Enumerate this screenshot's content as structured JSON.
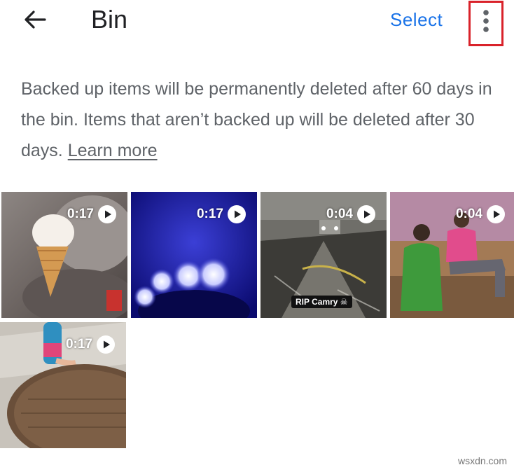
{
  "header": {
    "title": "Bin",
    "select_label": "Select",
    "back_icon": "arrow-back-icon",
    "more_icon": "more-vert-icon",
    "highlight_color": "#d9222a"
  },
  "info": {
    "text": "Backed up items will be permanently deleted after 60 days in the bin. Items that aren’t backed up will be deleted after 30 days.",
    "link_label": "Learn more"
  },
  "videos": [
    {
      "duration": "0:17",
      "icon": "play-icon"
    },
    {
      "duration": "0:17",
      "icon": "play-icon"
    },
    {
      "duration": "0:04",
      "icon": "play-icon",
      "caption": "RIP Camry ☠"
    },
    {
      "duration": "0:04",
      "icon": "play-icon"
    },
    {
      "duration": "0:17",
      "icon": "play-icon"
    }
  ],
  "watermark": "wsxdn.com"
}
